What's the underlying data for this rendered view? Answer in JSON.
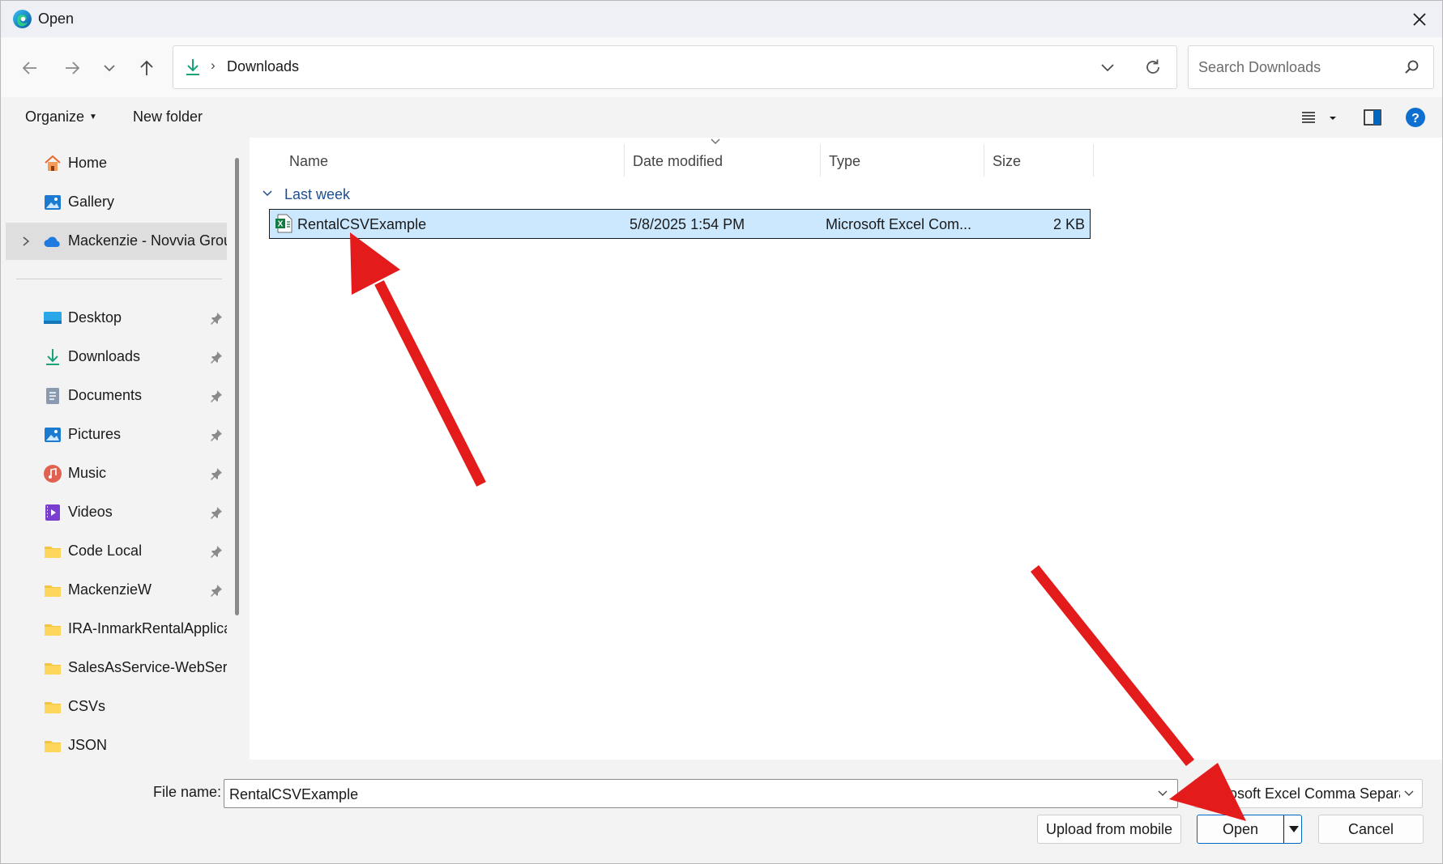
{
  "window": {
    "title": "Open"
  },
  "address": {
    "current_folder": "Downloads"
  },
  "search": {
    "placeholder": "Search Downloads"
  },
  "commands": {
    "organize_label": "Organize",
    "new_folder_label": "New folder"
  },
  "sidebar": {
    "items": [
      {
        "label": "Home",
        "icon": "home-icon"
      },
      {
        "label": "Gallery",
        "icon": "gallery-icon"
      },
      {
        "label": "Mackenzie - Novvia Grou",
        "icon": "onedrive-cloud-icon"
      },
      {
        "label": "Desktop",
        "icon": "desktop-icon"
      },
      {
        "label": "Downloads",
        "icon": "downloads-icon"
      },
      {
        "label": "Documents",
        "icon": "documents-icon"
      },
      {
        "label": "Pictures",
        "icon": "pictures-icon"
      },
      {
        "label": "Music",
        "icon": "music-icon"
      },
      {
        "label": "Videos",
        "icon": "videos-icon"
      },
      {
        "label": "Code Local",
        "icon": "folder-icon"
      },
      {
        "label": "MackenzieW",
        "icon": "folder-icon"
      },
      {
        "label": "IRA-InmarkRentalApplica",
        "icon": "folder-icon"
      },
      {
        "label": "SalesAsService-WebServi",
        "icon": "folder-icon"
      },
      {
        "label": "CSVs",
        "icon": "folder-icon"
      },
      {
        "label": "JSON",
        "icon": "folder-icon"
      }
    ]
  },
  "columns": {
    "name": "Name",
    "date": "Date modified",
    "type": "Type",
    "size": "Size"
  },
  "groups": [
    {
      "label": "Last week",
      "files": [
        {
          "name": "RentalCSVExample",
          "date": "5/8/2025 1:54 PM",
          "type": "Microsoft Excel Com...",
          "size": "2 KB"
        }
      ]
    }
  ],
  "footer": {
    "file_name_label": "File name:",
    "file_name_value": "RentalCSVExample",
    "file_type_value": "Microsoft Excel Comma Separat",
    "upload_label": "Upload from mobile",
    "open_label": "Open",
    "cancel_label": "Cancel"
  },
  "colors": {
    "accent": "#0067c0",
    "selection": "#cce8ff",
    "annotation_arrow": "#e31b1b"
  }
}
